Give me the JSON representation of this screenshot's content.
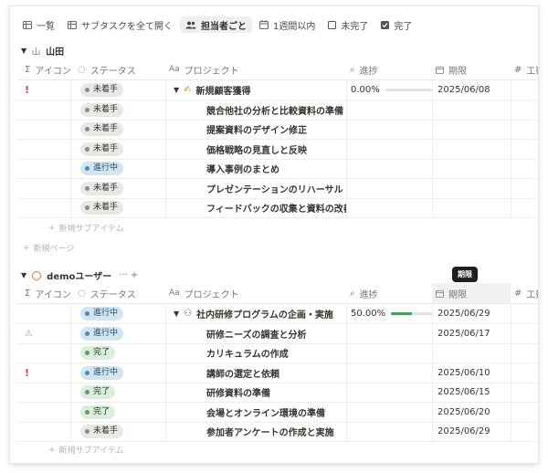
{
  "toolbar": {
    "items": [
      {
        "label": "一覧",
        "icon": "table-icon"
      },
      {
        "label": "サブタスクを全て開く",
        "icon": "table-icon"
      },
      {
        "label": "担当者ごと",
        "icon": "people-icon",
        "active": true
      },
      {
        "label": "1週間以内",
        "icon": "calendar-icon"
      },
      {
        "label": "未完了",
        "icon": "checkbox-empty-icon"
      },
      {
        "label": "完了",
        "icon": "checkbox-checked-icon"
      }
    ]
  },
  "columns": {
    "icon": "アイコン",
    "status": "ステータス",
    "project": "プロジェクト",
    "progress": "進捗",
    "due": "期限",
    "work": "工数"
  },
  "groups": [
    {
      "name": "山田",
      "extra": "",
      "parent": {
        "icon": "!",
        "status": "未着手",
        "status_kind": "todo",
        "project": "新規顧客獲得",
        "project_icon": "pen-emoji",
        "progress": "0.00%",
        "progress_value": 0.0,
        "due": "2025/06/08"
      },
      "children": [
        {
          "icon": "",
          "status": "未着手",
          "status_kind": "todo",
          "project": "競合他社の分析と比較資料の準備",
          "due": ""
        },
        {
          "icon": "",
          "status": "未着手",
          "status_kind": "todo",
          "project": "提案資料のデザイン修正",
          "due": ""
        },
        {
          "icon": "",
          "status": "未着手",
          "status_kind": "todo",
          "project": "価格戦略の見直しと反映",
          "due": ""
        },
        {
          "icon": "",
          "status": "進行中",
          "status_kind": "prog",
          "project": "導入事例のまとめ",
          "due": ""
        },
        {
          "icon": "",
          "status": "未着手",
          "status_kind": "todo",
          "project": "プレゼンテーションのリハーサル",
          "due": ""
        },
        {
          "icon": "",
          "status": "未着手",
          "status_kind": "todo",
          "project": "フィードバックの収集と資料の改善",
          "due": ""
        }
      ],
      "new_sub": "新規サブアイテム",
      "new_page": "新規ページ"
    },
    {
      "name": "demoユーザー",
      "extra": "··· +",
      "parent": {
        "icon": "",
        "status": "進行中",
        "status_kind": "prog",
        "project": "社内研修プログラムの企画・実施",
        "project_icon": "teacher-emoji",
        "progress": "50.00%",
        "progress_value": 0.5,
        "due": "2025/06/29"
      },
      "children": [
        {
          "icon": "⚠",
          "status": "進行中",
          "status_kind": "prog",
          "project": "研修ニーズの調査と分析",
          "due": "2025/06/17"
        },
        {
          "icon": "",
          "status": "完了",
          "status_kind": "done",
          "project": "カリキュラムの作成",
          "due": ""
        },
        {
          "icon": "!",
          "status": "進行中",
          "status_kind": "prog",
          "project": "講師の選定と依頼",
          "due": "2025/06/10"
        },
        {
          "icon": "",
          "status": "完了",
          "status_kind": "done",
          "project": "研修資料の準備",
          "due": "2025/06/15"
        },
        {
          "icon": "",
          "status": "完了",
          "status_kind": "done",
          "project": "会場とオンライン環境の準備",
          "due": "2025/06/20"
        },
        {
          "icon": "",
          "status": "未着手",
          "status_kind": "todo",
          "project": "参加者アンケートの作成と実施",
          "due": "2025/06/29"
        }
      ],
      "new_sub": "新規サブアイテム"
    }
  ],
  "tooltip": "期限"
}
